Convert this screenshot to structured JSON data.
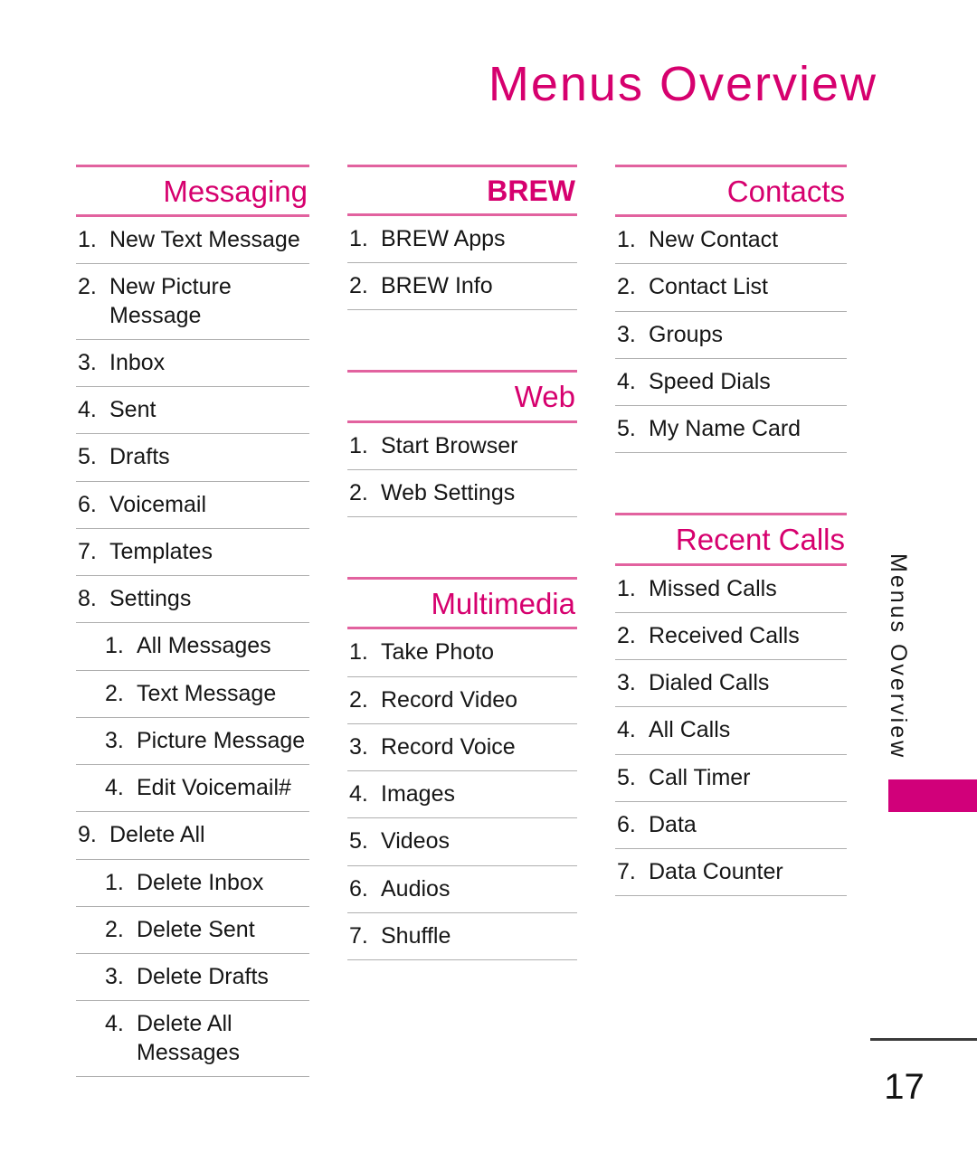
{
  "page": {
    "title": "Menus Overview",
    "side_tab_label": "Menus Overview",
    "page_number": "17",
    "accent_color": "#D6006E",
    "rule_color": "#E2629F",
    "tab_color": "#D1007A",
    "separator_color": "#AFAFAF"
  },
  "columns": [
    {
      "name": "column-1",
      "sections": [
        {
          "heading": "Messaging",
          "bold": false,
          "items": [
            {
              "num": "1.",
              "text": "New Text Message",
              "sub": false
            },
            {
              "num": "2.",
              "text": "New Picture Message",
              "sub": false
            },
            {
              "num": "3.",
              "text": "Inbox",
              "sub": false
            },
            {
              "num": "4.",
              "text": "Sent",
              "sub": false
            },
            {
              "num": "5.",
              "text": "Drafts",
              "sub": false
            },
            {
              "num": "6.",
              "text": "Voicemail",
              "sub": false
            },
            {
              "num": "7.",
              "text": "Templates",
              "sub": false
            },
            {
              "num": "8.",
              "text": "Settings",
              "sub": false
            },
            {
              "num": "1.",
              "text": "All Messages",
              "sub": true
            },
            {
              "num": "2.",
              "text": "Text Message",
              "sub": true
            },
            {
              "num": "3.",
              "text": "Picture Message",
              "sub": true
            },
            {
              "num": "4.",
              "text": "Edit Voicemail#",
              "sub": true
            },
            {
              "num": "9.",
              "text": "Delete All",
              "sub": false
            },
            {
              "num": "1.",
              "text": "Delete Inbox",
              "sub": true
            },
            {
              "num": "2.",
              "text": "Delete Sent",
              "sub": true
            },
            {
              "num": "3.",
              "text": "Delete Drafts",
              "sub": true
            },
            {
              "num": "4.",
              "text": "Delete All Messages",
              "sub": true
            }
          ]
        }
      ]
    },
    {
      "name": "column-2",
      "sections": [
        {
          "heading": "BREW",
          "bold": true,
          "items": [
            {
              "num": "1.",
              "text": "BREW Apps",
              "sub": false
            },
            {
              "num": "2.",
              "text": "BREW Info",
              "sub": false
            }
          ]
        },
        {
          "heading": "Web",
          "bold": false,
          "items": [
            {
              "num": "1.",
              "text": "Start Browser",
              "sub": false
            },
            {
              "num": "2.",
              "text": "Web Settings",
              "sub": false
            }
          ]
        },
        {
          "heading": "Multimedia",
          "bold": false,
          "items": [
            {
              "num": "1.",
              "text": "Take Photo",
              "sub": false
            },
            {
              "num": "2.",
              "text": "Record Video",
              "sub": false
            },
            {
              "num": "3.",
              "text": "Record Voice",
              "sub": false
            },
            {
              "num": "4.",
              "text": "Images",
              "sub": false
            },
            {
              "num": "5.",
              "text": "Videos",
              "sub": false
            },
            {
              "num": "6.",
              "text": "Audios",
              "sub": false
            },
            {
              "num": "7.",
              "text": "Shuffle",
              "sub": false
            }
          ]
        }
      ]
    },
    {
      "name": "column-3",
      "sections": [
        {
          "heading": "Contacts",
          "bold": false,
          "items": [
            {
              "num": "1.",
              "text": "New Contact",
              "sub": false
            },
            {
              "num": "2.",
              "text": "Contact List",
              "sub": false
            },
            {
              "num": "3.",
              "text": "Groups",
              "sub": false
            },
            {
              "num": "4.",
              "text": "Speed Dials",
              "sub": false
            },
            {
              "num": "5.",
              "text": "My Name Card",
              "sub": false
            }
          ]
        },
        {
          "heading": "Recent Calls",
          "bold": false,
          "items": [
            {
              "num": "1.",
              "text": "Missed Calls",
              "sub": false
            },
            {
              "num": "2.",
              "text": "Received Calls",
              "sub": false
            },
            {
              "num": "3.",
              "text": "Dialed Calls",
              "sub": false
            },
            {
              "num": "4.",
              "text": "All Calls",
              "sub": false
            },
            {
              "num": "5.",
              "text": "Call Timer",
              "sub": false
            },
            {
              "num": "6.",
              "text": "Data",
              "sub": false
            },
            {
              "num": "7.",
              "text": "Data Counter",
              "sub": false
            }
          ]
        }
      ]
    }
  ]
}
